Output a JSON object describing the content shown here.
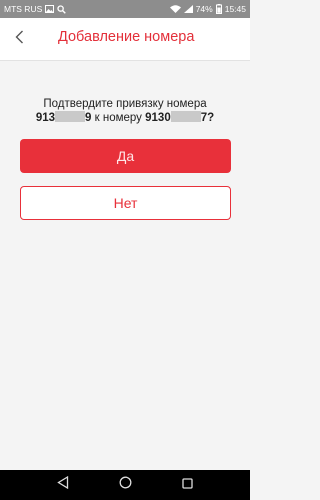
{
  "status_bar": {
    "carrier": "MTS RUS",
    "battery": "74%",
    "time": "15:45",
    "icons": [
      "gallery-icon",
      "search-icon",
      "wifi-icon",
      "cellular-signal-icon",
      "battery-icon"
    ]
  },
  "header": {
    "title": "Добавление номера",
    "back_icon": "chevron-left-icon",
    "accent_color": "#e3303a"
  },
  "prompt": {
    "line1": "Подтвердите привязку номера",
    "number1_prefix": "913",
    "number1_suffix": "9",
    "middle": "к номеру",
    "number2_prefix": "9130",
    "number2_suffix": "7?"
  },
  "buttons": {
    "yes_label": "Да",
    "no_label": "Нет"
  },
  "nav_bar": {
    "icons": [
      "back-triangle-icon",
      "home-circle-icon",
      "recents-square-icon"
    ]
  }
}
